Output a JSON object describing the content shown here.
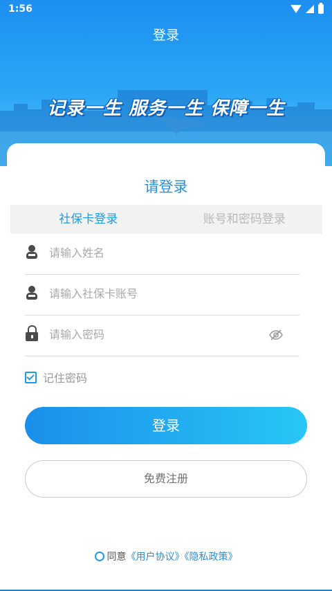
{
  "status_bar": {
    "time": "1:56"
  },
  "header": {
    "title": "登录",
    "slogan": "记录一生 服务一生 保障一生"
  },
  "login": {
    "heading": "请登录",
    "tabs": [
      {
        "label": "社保卡登录",
        "active": true
      },
      {
        "label": "账号和密码登录",
        "active": false
      }
    ],
    "fields": {
      "name_placeholder": "请输入姓名",
      "card_placeholder": "请输入社保卡账号",
      "password_placeholder": "请输入密码"
    },
    "remember_label": "记住密码",
    "remember_checked": true,
    "login_button": "登录",
    "register_button": "免费注册"
  },
  "agreement": {
    "prefix": "同意",
    "user_agreement": "《用户协议》",
    "privacy_policy": "《隐私政策》",
    "checked": false
  },
  "colors": {
    "accent": "#1e9be8",
    "header_top": "#1d8ff0",
    "header_bottom": "#5cc4fb",
    "button_start": "#1b8fea",
    "button_end": "#28c6f6"
  }
}
